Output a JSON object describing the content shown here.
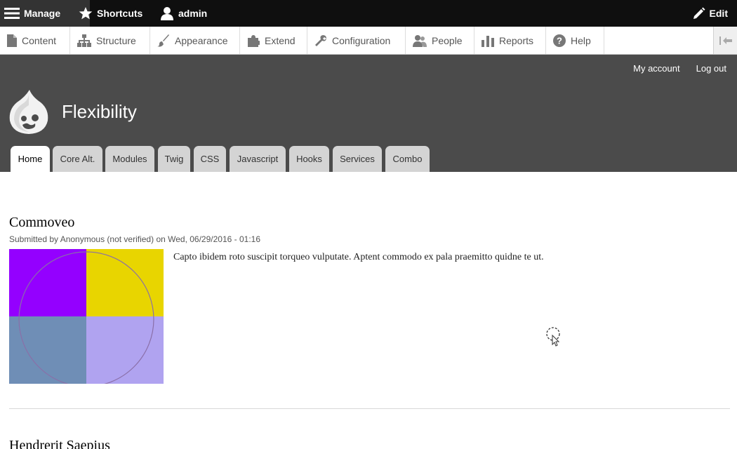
{
  "toolbar": {
    "manage": "Manage",
    "shortcuts": "Shortcuts",
    "user": "admin",
    "edit": "Edit"
  },
  "tray": {
    "items": [
      {
        "label": "Content",
        "icon": "file-icon"
      },
      {
        "label": "Structure",
        "icon": "sitemap-icon"
      },
      {
        "label": "Appearance",
        "icon": "paint-brush-icon"
      },
      {
        "label": "Extend",
        "icon": "puzzle-icon"
      },
      {
        "label": "Configuration",
        "icon": "wrench-icon"
      },
      {
        "label": "People",
        "icon": "people-icon"
      },
      {
        "label": "Reports",
        "icon": "bar-chart-icon"
      },
      {
        "label": "Help",
        "icon": "help-icon"
      }
    ]
  },
  "header": {
    "my_account": "My account",
    "log_out": "Log out",
    "site_name": "Flexibility",
    "tabs": [
      {
        "label": "Home"
      },
      {
        "label": "Core Alt."
      },
      {
        "label": "Modules"
      },
      {
        "label": "Twig"
      },
      {
        "label": "CSS"
      },
      {
        "label": "Javascript"
      },
      {
        "label": "Hooks"
      },
      {
        "label": "Services"
      },
      {
        "label": "Combo"
      }
    ]
  },
  "content": {
    "node1": {
      "title": "Commoveo",
      "submitted": "Submitted by Anonymous (not verified) on Wed, 06/29/2016 - 01:16",
      "body": "Capto ibidem roto suscipit torqueo vulputate. Aptent commodo ex pala praemitto quidne te ut.",
      "image_colors": [
        "#9400ff",
        "#e8d500",
        "#6f8eb6",
        "#b0a3f0"
      ]
    },
    "node2": {
      "title": "Hendrerit Saepius"
    }
  },
  "colors": {
    "toolbar_bg": "#0f0f0f",
    "header_bg": "#4b4b4b",
    "tab_bg": "#d4d4d4"
  }
}
